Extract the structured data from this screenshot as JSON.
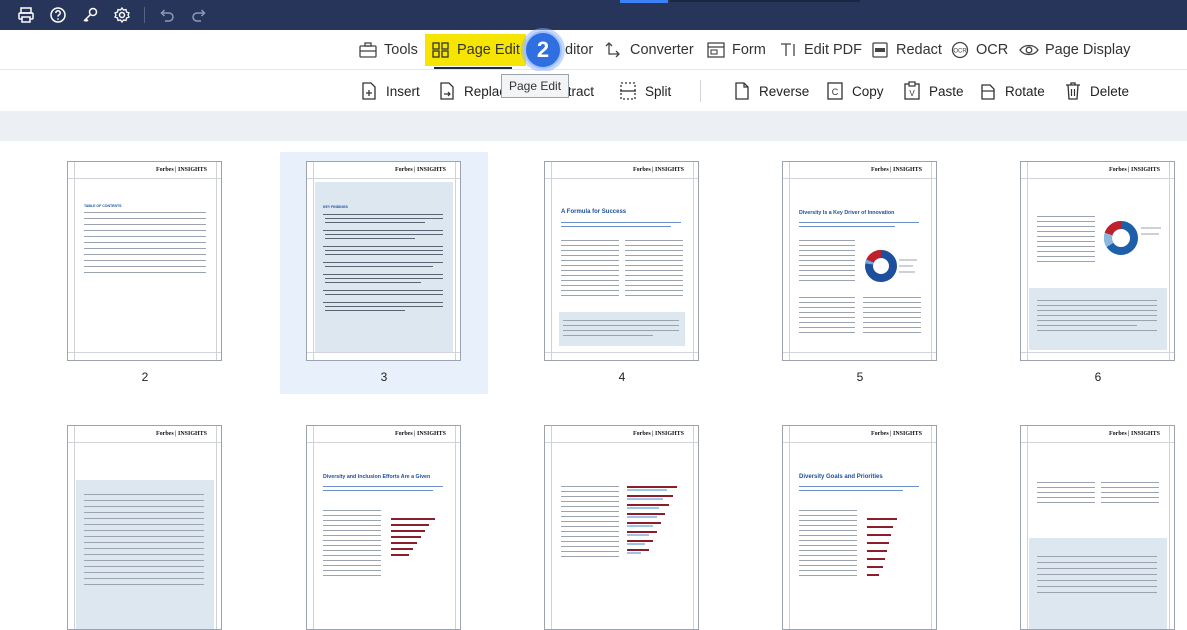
{
  "titlebar": {
    "icons": [
      "print-icon",
      "help-icon",
      "key-icon",
      "settings-icon",
      "undo-icon",
      "redo-icon"
    ]
  },
  "menu": {
    "items": [
      {
        "id": "tools",
        "label": "Tools",
        "icon": "toolbox-icon"
      },
      {
        "id": "page-edit",
        "label": "Page Edit",
        "icon": "grid-icon",
        "active": true
      },
      {
        "id": "editor",
        "label": "ditor",
        "icon": "edit-icon"
      },
      {
        "id": "converter",
        "label": "Converter",
        "icon": "convert-icon"
      },
      {
        "id": "form",
        "label": "Form",
        "icon": "form-icon"
      },
      {
        "id": "edit-pdf",
        "label": "Edit PDF",
        "icon": "text-cursor-icon"
      },
      {
        "id": "redact",
        "label": "Redact",
        "icon": "redact-icon"
      },
      {
        "id": "ocr",
        "label": "OCR",
        "icon": "ocr-icon"
      },
      {
        "id": "page-display",
        "label": "Page Display",
        "icon": "eye-icon"
      }
    ],
    "step_badge": "2"
  },
  "toolbar": {
    "tools": [
      {
        "id": "insert",
        "label": "Insert"
      },
      {
        "id": "replace",
        "label": "Replac"
      },
      {
        "id": "extract",
        "label": "xtract"
      },
      {
        "id": "split",
        "label": "Split"
      },
      {
        "id": "reverse",
        "label": "Reverse"
      },
      {
        "id": "copy",
        "label": "Copy"
      },
      {
        "id": "paste",
        "label": "Paste"
      },
      {
        "id": "rotate",
        "label": "Rotate"
      },
      {
        "id": "delete",
        "label": "Delete"
      }
    ],
    "tooltip": "Page Edit"
  },
  "thumbnails": {
    "brand": "Forbes | INSIGHTS",
    "row1": [
      {
        "number": "2",
        "selected": false
      },
      {
        "number": "3",
        "selected": true
      },
      {
        "number": "4",
        "selected": false
      },
      {
        "number": "5",
        "selected": false
      },
      {
        "number": "6",
        "selected": false
      }
    ],
    "titles": {
      "p2": "TABLE OF CONTENTS",
      "p3": "KEY FINDINGS",
      "p4": "A Formula for Success",
      "p5": "Diversity Is a Key Driver of Innovation",
      "p8": "Diversity and Inclusion Efforts Are a Given",
      "p10": "Diversity Goals and Priorities"
    }
  }
}
